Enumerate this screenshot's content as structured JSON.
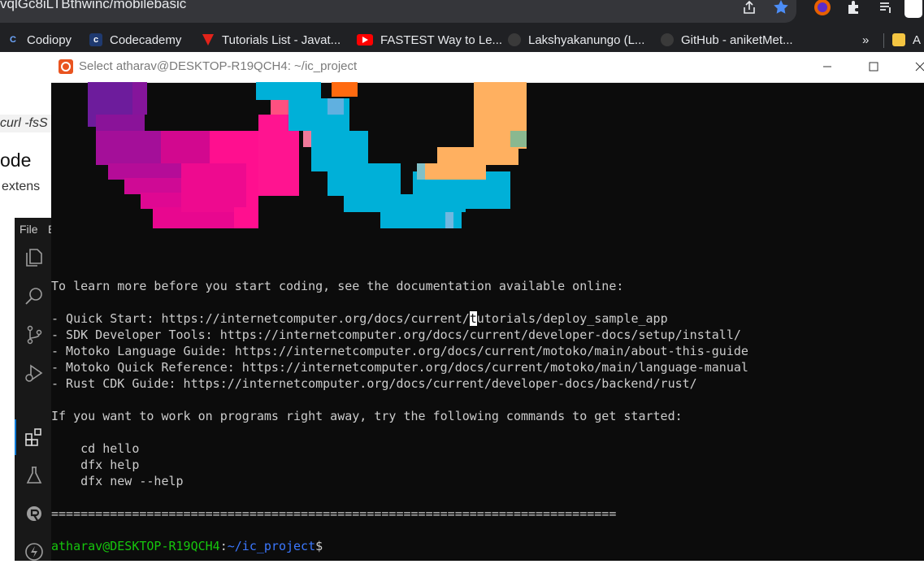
{
  "browser": {
    "url_text": "vqlGc8iLTBthwinc/mobilebasic",
    "bookmarks": [
      {
        "label": "Codiopy",
        "icon": "codiopy-icon"
      },
      {
        "label": "Codecademy",
        "icon": "codecademy-icon"
      },
      {
        "label": "Tutorials List - Javat...",
        "icon": "javatpoint-icon"
      },
      {
        "label": "FASTEST Way to Le...",
        "icon": "youtube-icon"
      },
      {
        "label": "Lakshyakanungo (L...",
        "icon": "github-icon"
      },
      {
        "label": "GitHub - aniketMet...",
        "icon": "github-icon"
      },
      {
        "label": "»",
        "icon": "overflow-chevron"
      },
      {
        "label": "A",
        "icon": "folder-icon"
      }
    ]
  },
  "background_page": {
    "code_fragment": "curl -fsS",
    "heading_fragment": "ode",
    "text_fragment": "extens"
  },
  "vscode": {
    "menu": [
      "File",
      "E"
    ]
  },
  "terminal": {
    "title": "Select atharav@DESKTOP-R19QCH4: ~/ic_project",
    "lines": {
      "intro": "To learn more before you start coding, see the documentation available online:",
      "quick_start_pre": "- Quick Start: https://internetcomputer.org/docs/current/",
      "quick_start_cursor": "t",
      "quick_start_post": "utorials/deploy_sample_app",
      "sdk": "- SDK Developer Tools: https://internetcomputer.org/docs/current/developer-docs/setup/install/",
      "motoko_guide": "- Motoko Language Guide: https://internetcomputer.org/docs/current/motoko/main/about-this-guide",
      "motoko_ref": "- Motoko Quick Reference: https://internetcomputer.org/docs/current/motoko/main/language-manual",
      "rust": "- Rust CDK Guide: https://internetcomputer.org/docs/current/developer-docs/backend/rust/",
      "commands_intro": "If you want to work on programs right away, try the following commands to get started:",
      "cmd1": "    cd hello",
      "cmd2": "    dfx help",
      "cmd3": "    dfx new --help",
      "rule": "=============================================================================",
      "prompt_user": "atharav@DESKTOP-R19QCH4",
      "prompt_sep": ":",
      "prompt_path": "~/ic_project",
      "prompt_end": "$"
    }
  },
  "colors": {
    "terminal_bg": "#0c0c0c",
    "terminal_fg": "#cccccc",
    "prompt_green": "#16c60c",
    "prompt_blue": "#3b78ff",
    "logo_purple": "#6d1c9c",
    "logo_magenta": "#ff0f8f",
    "logo_cyan": "#00b0d8",
    "logo_orange": "#ffb060"
  }
}
